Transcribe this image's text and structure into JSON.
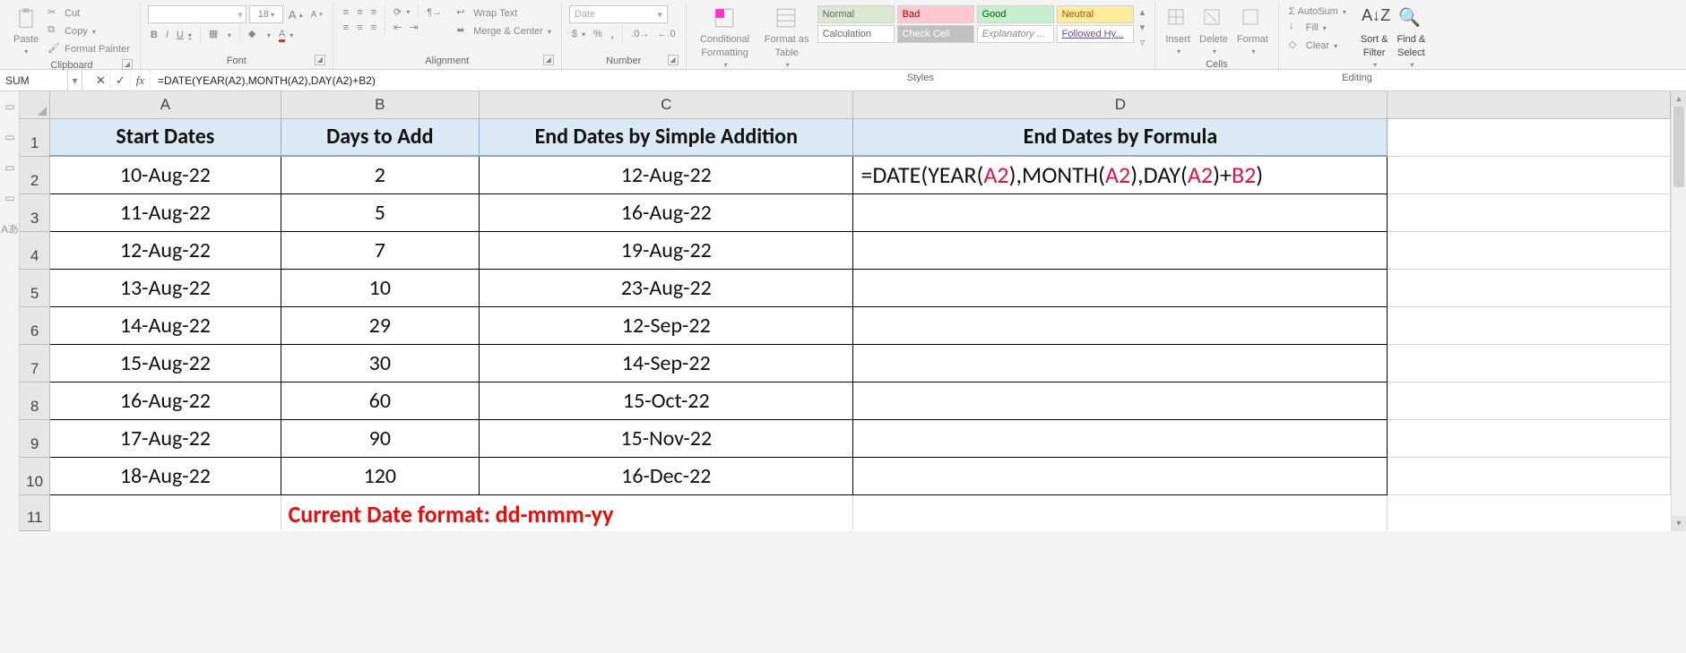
{
  "ribbon": {
    "clipboard": {
      "paste": "Paste",
      "cut": "Cut",
      "copy": "Copy",
      "format_painter": "Format Painter",
      "label": "Clipboard"
    },
    "font": {
      "size": "18",
      "increase": "A",
      "decrease": "A",
      "bold": "B",
      "italic": "I",
      "underline": "U",
      "label": "Font"
    },
    "alignment": {
      "wrap": "Wrap Text",
      "merge": "Merge & Center",
      "label": "Alignment"
    },
    "number": {
      "format": "Date",
      "currency": "$",
      "percent": "%",
      "comma": ",",
      "inc_dec": ".0",
      "dec_dec": ".0",
      "label": "Number"
    },
    "styles": {
      "cond": "Conditional Formatting",
      "cond1": "Conditional",
      "cond2": "Formatting",
      "fat1": "Format as",
      "fat2": "Table",
      "normal": "Normal",
      "bad": "Bad",
      "good": "Good",
      "neutral": "Neutral",
      "calc": "Calculation",
      "check": "Check Cell",
      "explan": "Explanatory ...",
      "hyper": "Followed Hy...",
      "label": "Styles"
    },
    "cells": {
      "insert": "Insert",
      "delete": "Delete",
      "format": "Format",
      "label": "Cells"
    },
    "editing": {
      "autosum": "AutoSum",
      "fill": "Fill",
      "clear": "Clear",
      "sort1": "Sort &",
      "sort2": "Filter",
      "find1": "Find &",
      "find2": "Select",
      "label": "Editing"
    }
  },
  "formula_bar": {
    "name_box": "SUM",
    "cancel": "✕",
    "enter": "✓",
    "fx": "fx",
    "formula": "=DATE(YEAR(A2),MONTH(A2),DAY(A2)+B2)"
  },
  "sheet": {
    "columns": [
      "A",
      "B",
      "C",
      "D"
    ],
    "headers": {
      "A": "Start Dates",
      "B": "Days to Add",
      "C": "End Dates by Simple Addition",
      "D": "End Dates by Formula"
    },
    "rows": [
      {
        "n": "1"
      },
      {
        "n": "2",
        "A": "10-Aug-22",
        "B": "2",
        "C": "12-Aug-22"
      },
      {
        "n": "3",
        "A": "11-Aug-22",
        "B": "5",
        "C": "16-Aug-22"
      },
      {
        "n": "4",
        "A": "12-Aug-22",
        "B": "7",
        "C": "19-Aug-22"
      },
      {
        "n": "5",
        "A": "13-Aug-22",
        "B": "10",
        "C": "23-Aug-22"
      },
      {
        "n": "6",
        "A": "14-Aug-22",
        "B": "29",
        "C": "12-Sep-22"
      },
      {
        "n": "7",
        "A": "15-Aug-22",
        "B": "30",
        "C": "14-Sep-22"
      },
      {
        "n": "8",
        "A": "16-Aug-22",
        "B": "60",
        "C": "15-Oct-22"
      },
      {
        "n": "9",
        "A": "17-Aug-22",
        "B": "90",
        "C": "15-Nov-22"
      },
      {
        "n": "10",
        "A": "18-Aug-22",
        "B": "120",
        "C": "16-Dec-22"
      },
      {
        "n": "11"
      }
    ],
    "active_formula_parts": {
      "p1": "=DATE(YEAR(",
      "a1": "A2",
      "p2": "),MONTH(",
      "a2": "A2",
      "p3": "),DAY(",
      "a3": "A2",
      "p4": ")+",
      "a4": "B2",
      "p5": ")"
    },
    "note": "Current Date format: dd-mmm-yy"
  },
  "icons": {
    "sigma": "Σ",
    "eraser": "◇",
    "down_arrow_small": "▾",
    "scissors": "✂",
    "clipboard": "📋",
    "brush": "🖌"
  }
}
